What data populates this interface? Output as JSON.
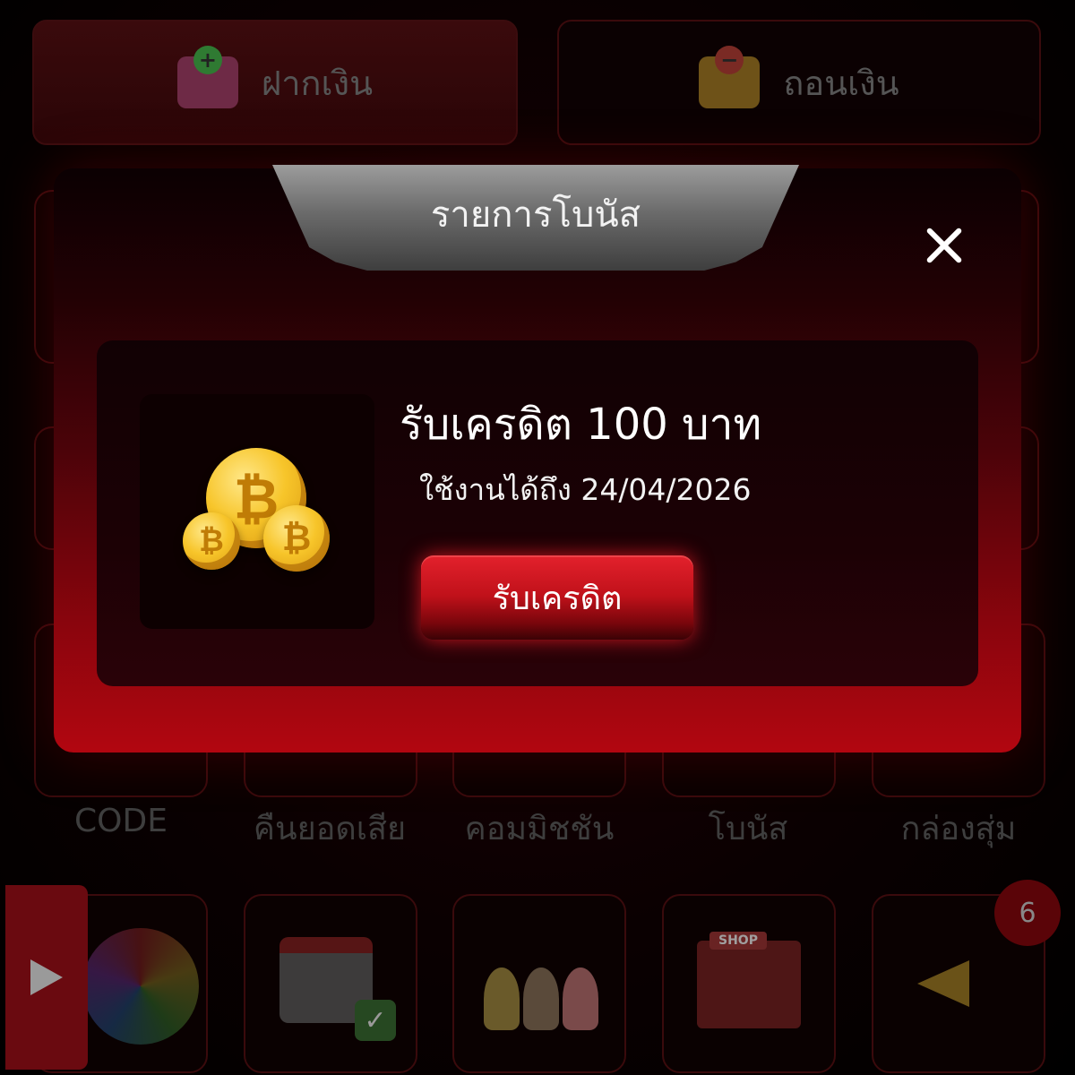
{
  "top_buttons": {
    "deposit_label": "ฝากเงิน",
    "withdraw_label": "ถอนเงิน"
  },
  "menu_labels": [
    "CODE",
    "คืนยอดเสีย",
    "คอมมิชชัน",
    "โบนัส",
    "กล่องสุ่ม"
  ],
  "notification_count": "6",
  "modal": {
    "title": "รายการโบนัส",
    "bonus": {
      "title": "รับเครดิต 100 บาท",
      "expiry": "ใช้งานได้ถึง 24/04/2026",
      "claim_label": "รับเครดิต"
    }
  },
  "icons": {
    "coin_symbol": "₿",
    "check_symbol": "✓",
    "deposit_badge": "+",
    "withdraw_badge": "−",
    "shop_sign": "SHOP"
  },
  "colors": {
    "accent_red": "#e3212c",
    "modal_bottom": "#b20610",
    "coin_gold": "#f7c52a"
  }
}
